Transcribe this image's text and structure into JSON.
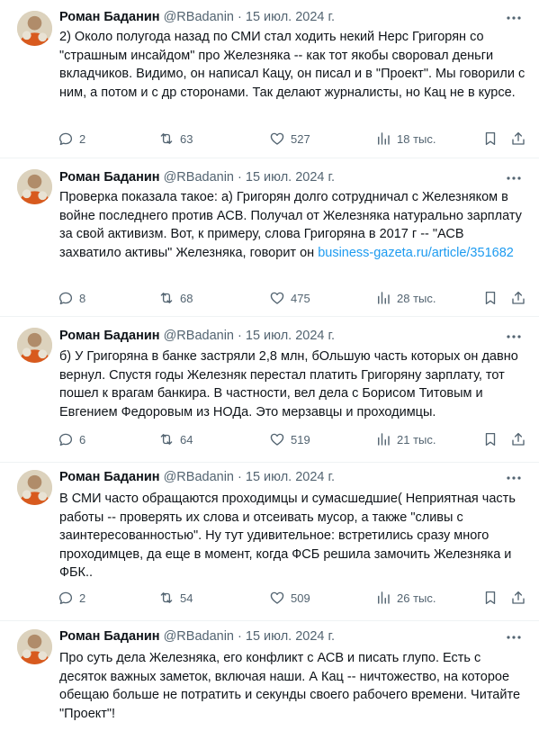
{
  "author": {
    "name": "Роман Баданин",
    "handle": "@RBadanin",
    "separator": "·",
    "date": "15 июл. 2024 г."
  },
  "icons": {
    "more": "more-horizontal-icon",
    "reply": "reply-icon",
    "retweet": "retweet-icon",
    "like": "heart-icon",
    "views": "views-icon",
    "bookmark": "bookmark-icon",
    "share": "share-icon"
  },
  "colors": {
    "text": "#0f1419",
    "muted": "#536471",
    "link": "#1d9bf0",
    "divider": "#eff3f4"
  },
  "tweets": [
    {
      "text": "2) Около полугода назад по СМИ стал ходить некий Нерс Григорян со \"страшным инсайдом\" про Железняка -- как тот якобы своровал деньги вкладчиков. Видимо, он написал Кацу, он писал и в \"Проект\". Мы говорили с ним, а потом и с др сторонами. Так делают журналисты, но Кац не в курсе.",
      "link": "",
      "replies": "2",
      "retweets": "63",
      "likes": "527",
      "views": "18 тыс."
    },
    {
      "text": "Проверка показала такое: а) Григорян долго сотрудничал с Железняком в войне последнего против АСВ. Получал от Железняка натурально зарплату за свой активизм. Вот, к примеру, слова Григоряна в 2017 г -- \"АСВ захватило активы\" Железняка, говорит он ",
      "link": "business-gazeta.ru/article/351682",
      "replies": "8",
      "retweets": "68",
      "likes": "475",
      "views": "28 тыс."
    },
    {
      "text": "б) У Григоряна в банке застряли 2,8 млн, бОльшую часть которых он давно вернул. Спустя годы Железняк перестал платить Григоряну зарплату, тот пошел к врагам банкира. В частности, вел дела с Борисом Титовым и Евгением Федоровым из НОДа. Это мерзавцы и проходимцы.",
      "link": "",
      "replies": "6",
      "retweets": "64",
      "likes": "519",
      "views": "21 тыс."
    },
    {
      "text": "В СМИ часто обращаются проходимцы и сумасшедшие( Неприятная часть работы -- проверять их слова и отсеивать мусор, а также \"сливы с заинтересованностью\". Ну тут удивительное: встретились сразу много проходимцев, да еще в момент, когда ФСБ решила замочить Железняка и ФБК..",
      "link": "",
      "replies": "2",
      "retweets": "54",
      "likes": "509",
      "views": "26 тыс."
    },
    {
      "text": "Про суть дела Железняка, его конфликт с АСВ и писать глупо. Есть с десяток важных заметок, включая наши. А Кац -- ничтожество, на которое обещаю больше не потратить и секунды своего рабочего времени. Читайте \"Проект\"!",
      "link": "",
      "replies": "",
      "retweets": "",
      "likes": "",
      "views": ""
    }
  ]
}
